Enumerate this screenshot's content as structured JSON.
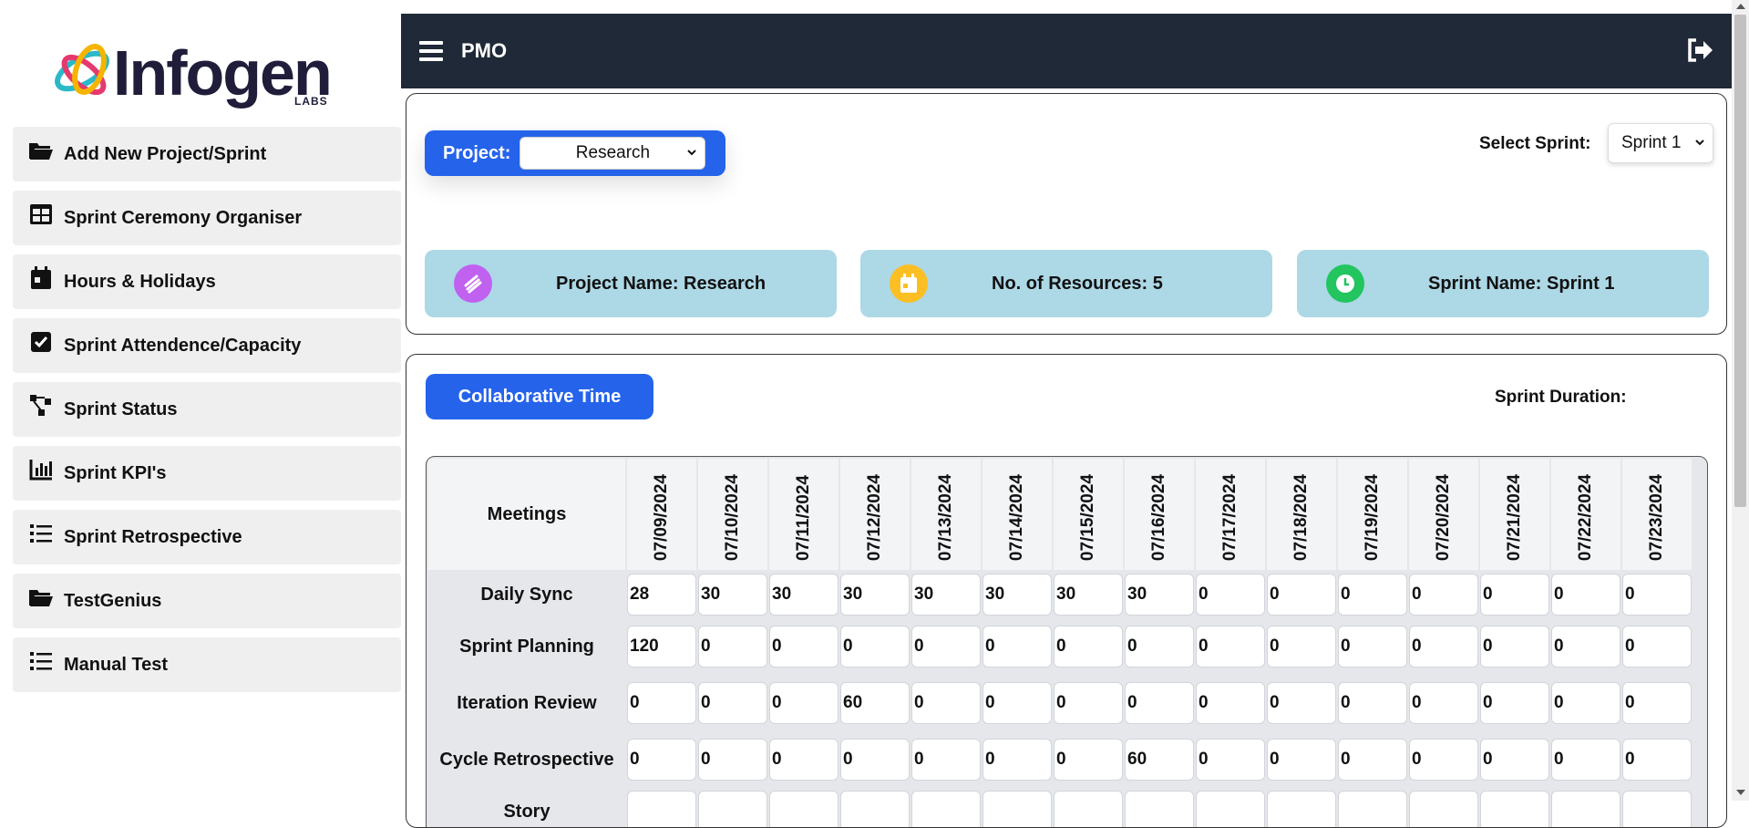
{
  "brand": {
    "name": "Infogen",
    "sub": "LABS"
  },
  "sidebar": {
    "items": [
      {
        "label": "Add New Project/Sprint",
        "icon": "folder-open-icon"
      },
      {
        "label": "Sprint Ceremony Organiser",
        "icon": "grid-table-icon"
      },
      {
        "label": "Hours & Holidays",
        "icon": "calendar-icon"
      },
      {
        "label": "Sprint Attendence/Capacity",
        "icon": "check-square-icon"
      },
      {
        "label": "Sprint Status",
        "icon": "workflow-icon"
      },
      {
        "label": "Sprint KPI's",
        "icon": "bar-chart-icon"
      },
      {
        "label": "Sprint Retrospective",
        "icon": "list-icon"
      },
      {
        "label": "TestGenius",
        "icon": "folder-open-icon"
      },
      {
        "label": "Manual Test",
        "icon": "list-icon"
      }
    ]
  },
  "header": {
    "title": "PMO"
  },
  "project": {
    "label": "Project:",
    "selected": "Research"
  },
  "sprint": {
    "label": "Select Sprint:",
    "selected": "Sprint 1"
  },
  "info_cards": [
    {
      "text": "Project Name: Research",
      "color": "#c061f0",
      "icon": "layers-icon"
    },
    {
      "text": "No. of Resources: 5",
      "color": "#fbbf24",
      "icon": "calendar-icon"
    },
    {
      "text": "Sprint Name: Sprint 1",
      "color": "#22c55e",
      "icon": "clock-icon"
    }
  ],
  "collab": {
    "button": "Collaborative Time",
    "duration_label": "Sprint Duration:"
  },
  "table": {
    "meetings_header": "Meetings",
    "dates": [
      "07/09/2024",
      "07/10/2024",
      "07/11/2024",
      "07/12/2024",
      "07/13/2024",
      "07/14/2024",
      "07/15/2024",
      "07/16/2024",
      "07/17/2024",
      "07/18/2024",
      "07/19/2024",
      "07/20/2024",
      "07/21/2024",
      "07/22/2024",
      "07/23/2024"
    ],
    "rows": [
      {
        "label": "Daily Sync",
        "values": [
          "28",
          "30",
          "30",
          "30",
          "30",
          "30",
          "30",
          "30",
          "0",
          "0",
          "0",
          "0",
          "0",
          "0",
          "0"
        ]
      },
      {
        "label": "Sprint Planning",
        "values": [
          "120",
          "0",
          "0",
          "0",
          "0",
          "0",
          "0",
          "0",
          "0",
          "0",
          "0",
          "0",
          "0",
          "0",
          "0"
        ]
      },
      {
        "label": "Iteration Review",
        "values": [
          "0",
          "0",
          "0",
          "60",
          "0",
          "0",
          "0",
          "0",
          "0",
          "0",
          "0",
          "0",
          "0",
          "0",
          "0"
        ]
      },
      {
        "label": "Cycle Retrospective",
        "values": [
          "0",
          "0",
          "0",
          "0",
          "0",
          "0",
          "0",
          "60",
          "0",
          "0",
          "0",
          "0",
          "0",
          "0",
          "0"
        ]
      },
      {
        "label": "Story",
        "values": [
          "",
          "",
          "",
          "",
          "",
          "",
          "",
          "",
          "",
          "",
          "",
          "",
          "",
          "",
          ""
        ]
      }
    ]
  },
  "colors": {
    "primary": "#2563eb",
    "topbar": "#1f2937",
    "info_bg": "#add8e6"
  }
}
